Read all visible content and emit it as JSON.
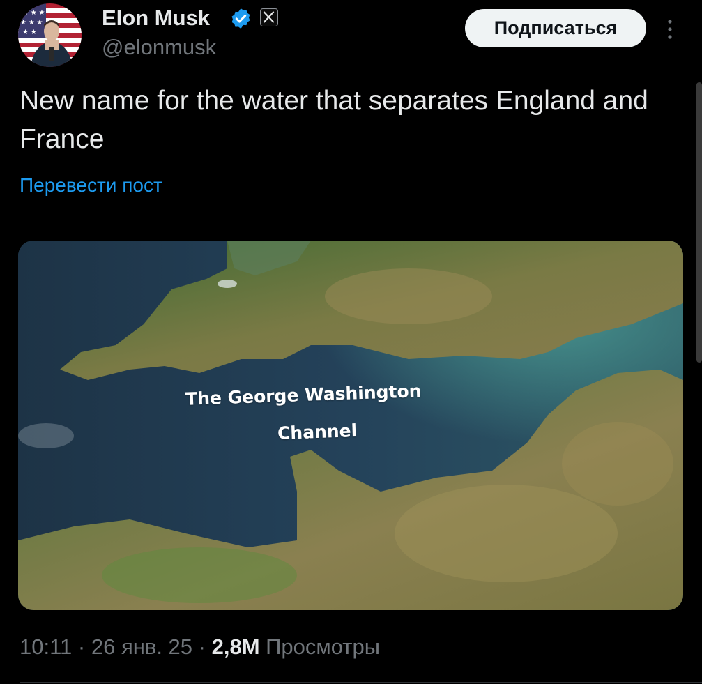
{
  "author": {
    "display_name": "Elon Musk",
    "handle": "@elonmusk",
    "verified_color": "#1d9bf0"
  },
  "header": {
    "subscribe_label": "Подписаться",
    "more_icon": "more-vertical-icon"
  },
  "post": {
    "text": "New name for the water that separates England and France",
    "translate_label": "Перевести пост",
    "image": {
      "label_line_1": "The George Washington",
      "label_line_2": "Channel"
    }
  },
  "meta": {
    "time": "10:11",
    "separator": " · ",
    "date": "26 янв. 25",
    "views_count": "2,8M",
    "views_label": "Просмотры"
  },
  "colors": {
    "background": "#000000",
    "text_primary": "#e7e9ea",
    "text_secondary": "#71767b",
    "link": "#1d9bf0",
    "button_bg": "#eff3f4"
  }
}
